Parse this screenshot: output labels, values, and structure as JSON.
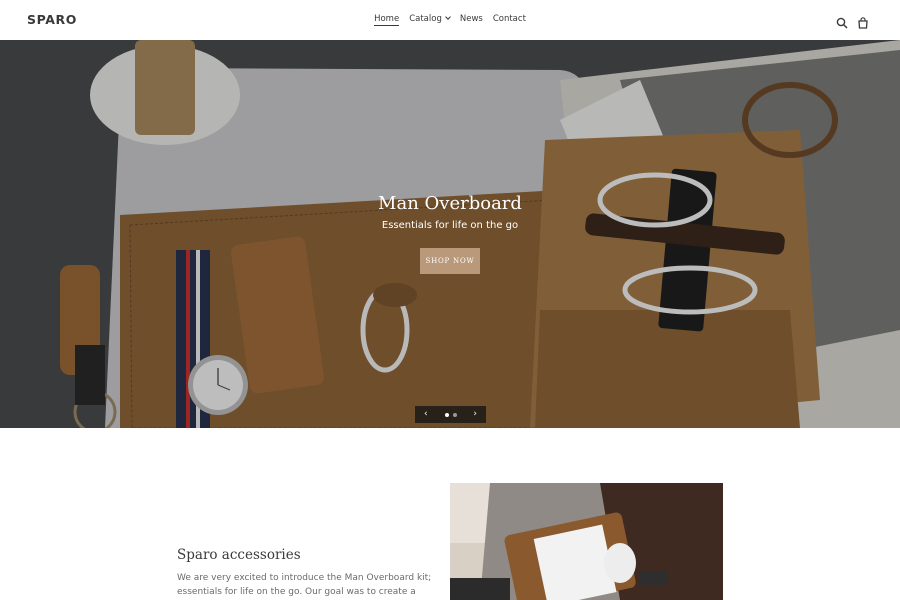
{
  "header": {
    "logo": "SPARO",
    "nav": [
      {
        "label": "Home",
        "active": true
      },
      {
        "label": "Catalog",
        "has_dropdown": true
      },
      {
        "label": "News"
      },
      {
        "label": "Contact"
      }
    ],
    "icons": [
      "search-icon",
      "cart-icon"
    ]
  },
  "hero": {
    "title": "Man Overboard",
    "subtitle": "Essentials for life on the go",
    "button_label": "SHOP NOW",
    "slider": {
      "prev_icon": "‹",
      "next_icon": "›",
      "slide_count": 2,
      "current": 1
    }
  },
  "section": {
    "title": "Sparo accessories",
    "text": "We are very excited to introduce the Man Overboard kit; essentials for life on the go. Our goal was to create a beautiful set of leather"
  },
  "colors": {
    "accent_button": "#b9997a",
    "text": "#3a3a3a",
    "muted_text": "#6b6b6b",
    "slider_bg": "#1a1a1a"
  }
}
